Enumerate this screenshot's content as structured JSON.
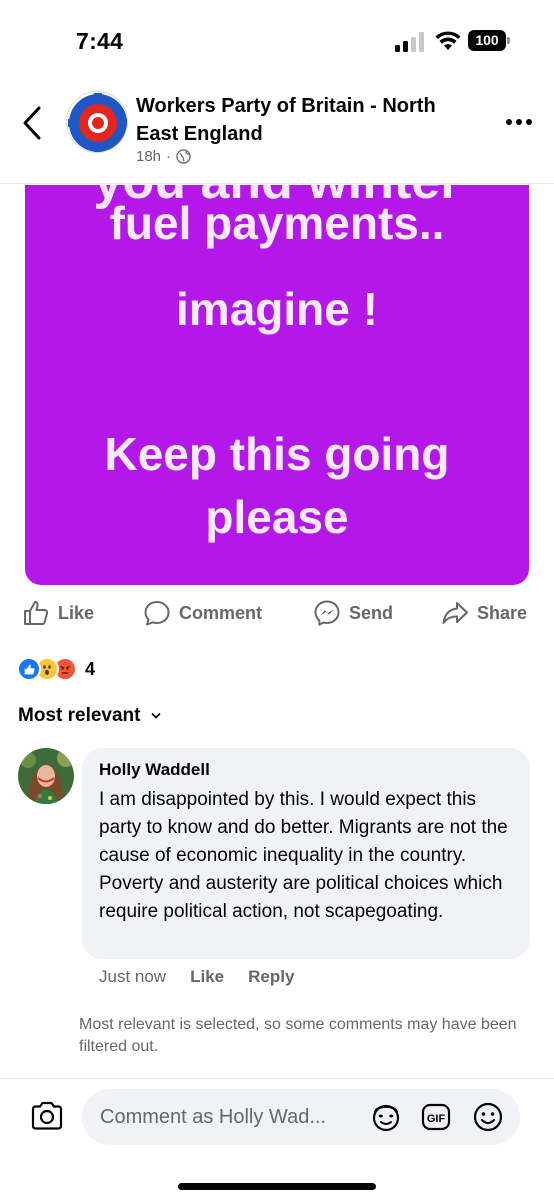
{
  "status_bar": {
    "time": "7:44",
    "battery": "100"
  },
  "post": {
    "page_name": "Workers Party of Britain - North East England",
    "time_ago": "18h",
    "separator": "·",
    "image_lines": [
      "fuel payments..",
      "imagine !",
      "Keep this going",
      "please"
    ],
    "image_partial_line": "you and winter",
    "image_bg_color": "#b418e8"
  },
  "actions": {
    "like": "Like",
    "comment": "Comment",
    "send": "Send",
    "share": "Share"
  },
  "reactions": {
    "types": [
      "like",
      "wow",
      "angry"
    ],
    "count": "4"
  },
  "sort": {
    "label": "Most relevant"
  },
  "comment": {
    "author": "Holly Waddell",
    "text": "I am disappointed by this. I would expect this party to know and do better. Migrants are not the cause of economic inequality in the country. Poverty and austerity are political choices which require political action, not scapegoating.",
    "time": "Just now",
    "like": "Like",
    "reply": "Reply"
  },
  "filter_note": "Most relevant is selected, so some comments may have been filtered out.",
  "composer": {
    "placeholder": "Comment as Holly Wad..."
  }
}
